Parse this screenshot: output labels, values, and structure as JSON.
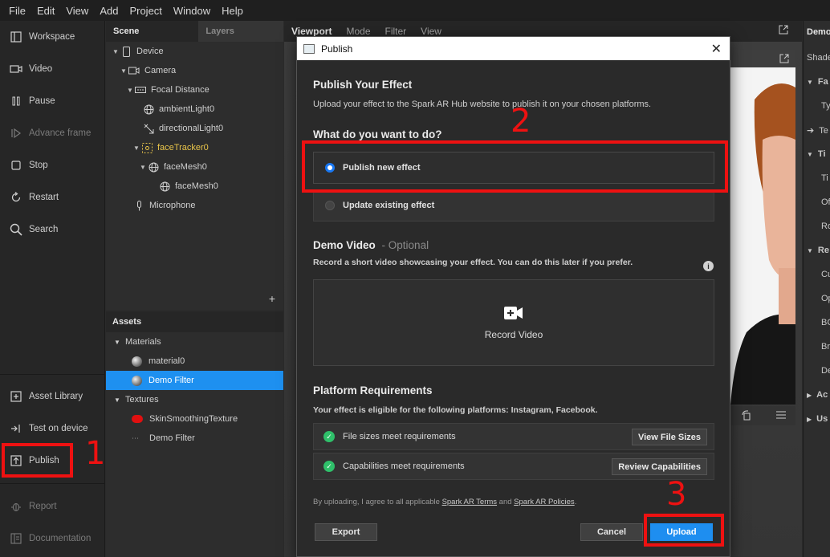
{
  "menu": [
    "File",
    "Edit",
    "View",
    "Add",
    "Project",
    "Window",
    "Help"
  ],
  "toolbar": {
    "workspace": "Workspace",
    "video": "Video",
    "pause": "Pause",
    "advance_frame": "Advance frame",
    "stop": "Stop",
    "restart": "Restart",
    "search": "Search",
    "asset_library": "Asset Library",
    "test_on_device": "Test on device",
    "publish": "Publish",
    "report": "Report",
    "documentation": "Documentation"
  },
  "scene": {
    "tab_scene": "Scene",
    "tab_layers": "Layers",
    "items": [
      "Device",
      "Camera",
      "Focal Distance",
      "ambientLight0",
      "directionalLight0",
      "faceTracker0",
      "faceMesh0",
      "faceMesh0",
      "Microphone"
    ]
  },
  "assets": {
    "title": "Assets",
    "materials_label": "Materials",
    "material0": "material0",
    "demo_filter": "Demo Filter",
    "textures_label": "Textures",
    "skin_texture": "SkinSmoothingTexture",
    "demo_filter_texture": "Demo Filter"
  },
  "viewport": {
    "tabs": [
      "Viewport",
      "Mode",
      "Filter",
      "View"
    ]
  },
  "right_panel": {
    "title": "Demo",
    "rows": [
      "Shade",
      "Fa",
      "Ty",
      "Te",
      "Ti",
      "Ti",
      "Of",
      "Ro",
      "Re",
      "Cu",
      "Op",
      "BC",
      "Br",
      "De",
      "Ac",
      "Us"
    ]
  },
  "dialog": {
    "title": "Publish",
    "heading": "Publish Your Effect",
    "intro": "Upload your effect to the Spark AR Hub website to publish it on your chosen platforms.",
    "question": "What do you want to do?",
    "option_new": "Publish new effect",
    "option_update": "Update existing effect",
    "demo_heading": "Demo Video",
    "demo_optional": "- Optional",
    "demo_desc": "Record a short video showcasing your effect. You can do this later if you prefer.",
    "record_label": "Record Video",
    "platform_heading": "Platform Requirements",
    "platform_desc": "Your effect is eligible for the following platforms: Instagram, Facebook.",
    "req1": "File sizes meet requirements",
    "req1_btn": "View File Sizes",
    "req2": "Capabilities meet requirements",
    "req2_btn": "Review Capabilities",
    "legal_prefix": "By uploading, I agree to all applicable",
    "legal_terms": "Spark AR Terms",
    "legal_and": "and",
    "legal_policies": "Spark AR Policies",
    "legal_suffix": ".",
    "export": "Export",
    "cancel": "Cancel",
    "upload": "Upload"
  },
  "annotations": [
    "1",
    "2",
    "3"
  ],
  "colors": {
    "accent": "#1e8ef0",
    "annotation": "#ee1111",
    "selected_row": "#1e90f0",
    "check": "#2fc06a"
  }
}
